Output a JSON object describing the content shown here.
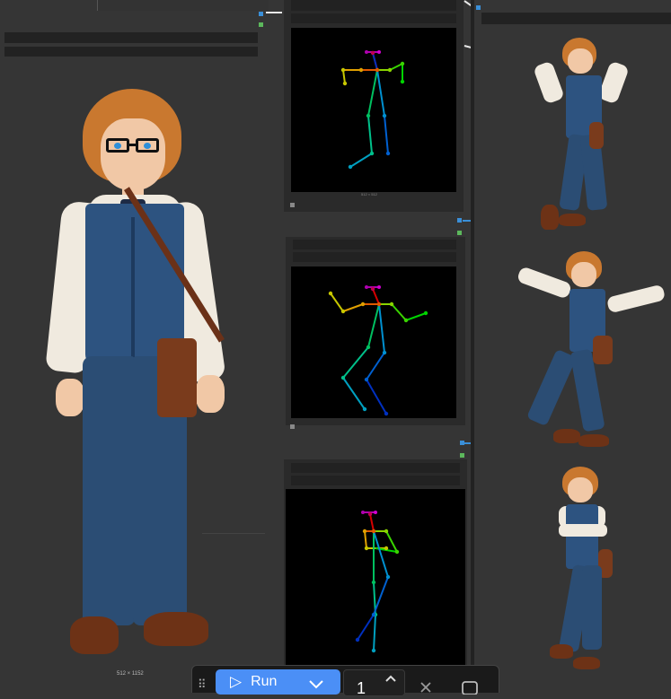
{
  "main_image": {
    "resolution_label": "512 × 1152"
  },
  "pose_node_top": {
    "footer_label": "512 × 512"
  },
  "toolbar": {
    "run_label": "Run",
    "batch_count": "1",
    "drag_glyph": "⠿",
    "run_icon": "▷",
    "dropdown_icon": "chevron-down-icon",
    "increment_icon": "chevron-up-icon",
    "close_icon": "close-icon",
    "stop_icon": "square-icon"
  },
  "colors": {
    "canvas": "#353535",
    "node": "#2a2a2a",
    "accent": "#4b8ff6",
    "handle_blue": "#3a8fd8",
    "handle_green": "#5cb85c"
  }
}
